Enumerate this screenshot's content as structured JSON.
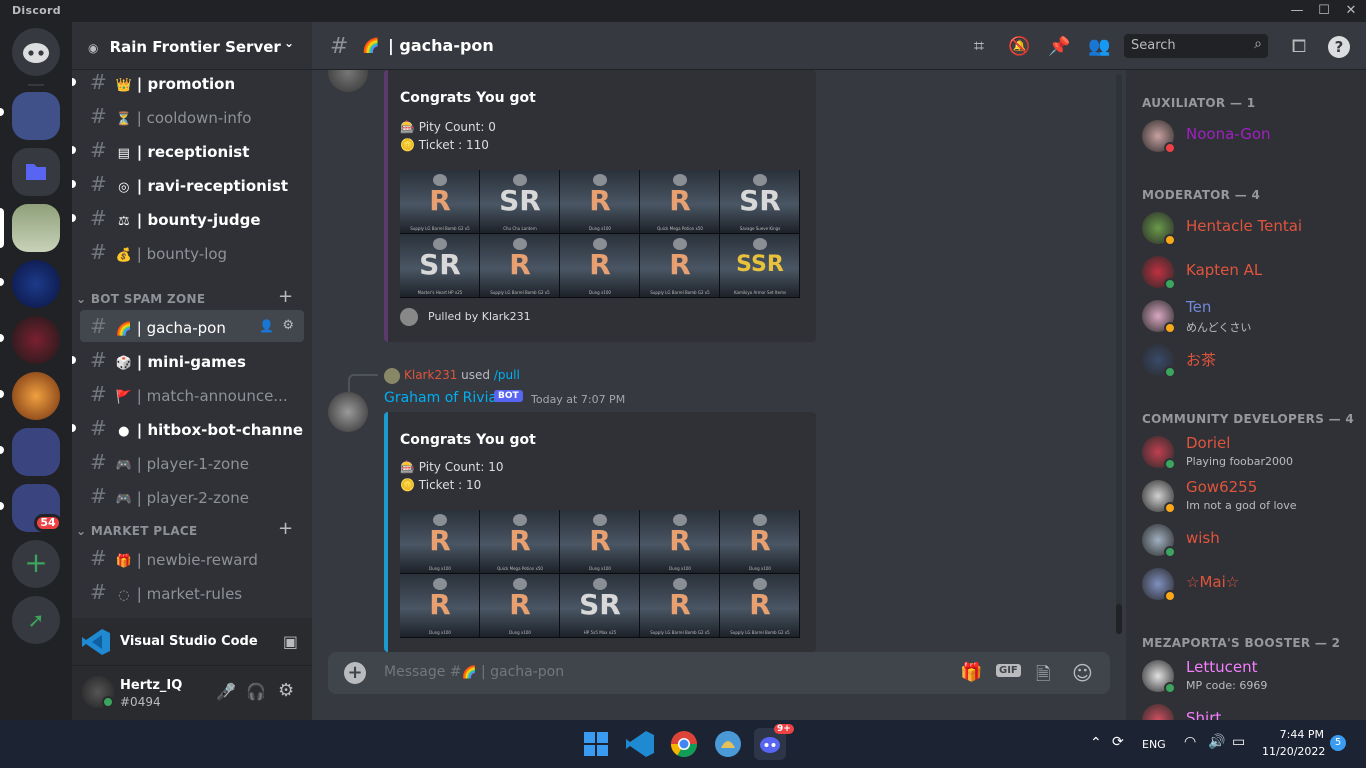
{
  "app": {
    "title": "Discord"
  },
  "window_controls": {
    "minimize": "—",
    "maximize": "☐",
    "close": "✕"
  },
  "servers": {
    "badge": "54",
    "add_label": "+",
    "explore_label": "➚"
  },
  "server": {
    "name": "Rain Frontier Server"
  },
  "channels": [
    {
      "emoji": "👑",
      "name": "| promotion",
      "unread": true
    },
    {
      "emoji": "⏳",
      "name": "| cooldown-info",
      "unread": false
    },
    {
      "emoji": "▤",
      "name": "| receptionist",
      "unread": true
    },
    {
      "emoji": "◎",
      "name": "| ravi-receptionist",
      "unread": true
    },
    {
      "emoji": "⚖",
      "name": "| bounty-judge",
      "unread": true
    },
    {
      "emoji": "💰",
      "name": "| bounty-log",
      "unread": false
    }
  ],
  "categories": {
    "bot_spam": "BOT SPAM ZONE",
    "market": "MARKET PLACE"
  },
  "bot_channels": [
    {
      "emoji": "🌈",
      "name": "| gacha-pon",
      "active": true,
      "unread": false
    },
    {
      "emoji": "🎲",
      "name": "| mini-games",
      "active": false,
      "unread": true
    },
    {
      "emoji": "🚩",
      "name": "| match-announce...",
      "active": false,
      "unread": false
    },
    {
      "emoji": "●",
      "name": "| hitbox-bot-channel",
      "active": false,
      "unread": true
    },
    {
      "emoji": "🎮",
      "name": "| player-1-zone",
      "active": false,
      "unread": false
    },
    {
      "emoji": "🎮",
      "name": "| player-2-zone",
      "active": false,
      "unread": false
    }
  ],
  "market_channels": [
    {
      "emoji": "🎁",
      "name": "| newbie-reward"
    },
    {
      "emoji": "◌",
      "name": "| market-rules"
    }
  ],
  "activity": {
    "name": "Visual Studio Code"
  },
  "user": {
    "name": "Hertz_IQ",
    "tag": "#0494"
  },
  "header": {
    "channel": "| gacha-pon",
    "search_placeholder": "Search"
  },
  "messages": {
    "first": {
      "title": "Congrats You got",
      "pity": "Pity Count: 0",
      "ticket": "Ticket : 110",
      "footer": "Pulled by Klark231",
      "cards": [
        {
          "rank": "R",
          "cap": "Supply LG Barrel Bomb G2 x5"
        },
        {
          "rank": "SR",
          "cap": "Chu Chu Lantern"
        },
        {
          "rank": "R",
          "cap": "Dung x100"
        },
        {
          "rank": "R",
          "cap": "Quick Mega Potion x50"
        },
        {
          "rank": "SR",
          "cap": "Savage Sueve Kings"
        },
        {
          "rank": "SR",
          "cap": "Master's Heart HP x25"
        },
        {
          "rank": "R",
          "cap": "Supply LG Barrel Bomb G2 x5"
        },
        {
          "rank": "R",
          "cap": "Dung x100"
        },
        {
          "rank": "R",
          "cap": "Supply LG Barrel Bomb G2 x5"
        },
        {
          "rank": "SSR",
          "cap": "Kamikiyo Armor Set Items"
        }
      ]
    },
    "second": {
      "reply_user": "Klark231",
      "reply_used": "used",
      "reply_cmd": "/pull",
      "author": "Graham of Rivia",
      "bot_tag": "BOT",
      "time": "Today at 7:07 PM",
      "title": "Congrats You got",
      "pity": "Pity Count: 10",
      "ticket": "Ticket : 10",
      "cards": [
        {
          "rank": "R",
          "cap": "Dung x100"
        },
        {
          "rank": "R",
          "cap": "Quick Mega Potion x50"
        },
        {
          "rank": "R",
          "cap": "Dung x100"
        },
        {
          "rank": "R",
          "cap": "Dung x100"
        },
        {
          "rank": "R",
          "cap": "Dung x100"
        },
        {
          "rank": "R",
          "cap": "Dung x100"
        },
        {
          "rank": "R",
          "cap": "Dung x100"
        },
        {
          "rank": "SR",
          "cap": "HP 5x5 Max x25"
        },
        {
          "rank": "R",
          "cap": "Supply LG Barrel Bomb G2 x5"
        },
        {
          "rank": "R",
          "cap": "Supply LG Barrel Bomb G2 x5"
        }
      ]
    }
  },
  "composer": {
    "placeholder_prefix": "Message #",
    "placeholder_channel": "| gacha-pon",
    "gif": "GIF"
  },
  "members": {
    "groups": [
      {
        "label": "AUXILIATOR — 1",
        "members": [
          {
            "name": "Noona-Gon",
            "color": "#a020c0",
            "sub": "",
            "status": "#ed4245"
          }
        ]
      },
      {
        "label": "MODERATOR — 4",
        "members": [
          {
            "name": "Hentacle Tentai",
            "color": "#e0543c",
            "sub": "",
            "status": "#faa81a"
          },
          {
            "name": "Kapten AL",
            "color": "#e0543c",
            "sub": "",
            "status": "#3ba55d"
          },
          {
            "name": "Ten",
            "color": "#7289da",
            "sub": "めんどくさい",
            "status": "#faa81a"
          },
          {
            "name": "お茶",
            "color": "#e0543c",
            "sub": "",
            "status": "#3ba55d"
          }
        ]
      },
      {
        "label": "COMMUNITY DEVELOPERS — 4",
        "members": [
          {
            "name": "Doriel",
            "color": "#e0543c",
            "sub": "Playing foobar2000",
            "status": "#3ba55d"
          },
          {
            "name": "Gow6255",
            "color": "#e0543c",
            "sub": "Im not a god of love",
            "status": "#faa81a"
          },
          {
            "name": "wish",
            "color": "#e0543c",
            "sub": "",
            "status": "#3ba55d"
          },
          {
            "name": "☆Mai☆",
            "color": "#e0543c",
            "sub": "",
            "status": "#faa81a"
          }
        ]
      },
      {
        "label": "MEZAPORTA'S BOOSTER — 2",
        "members": [
          {
            "name": "Lettucent",
            "color": "#f47fff",
            "sub": "MP code: 6969",
            "status": "#3ba55d"
          },
          {
            "name": "Shirt",
            "color": "#f47fff",
            "sub": "",
            "status": "#faa81a"
          }
        ]
      }
    ]
  },
  "taskbar": {
    "lang": "ENG",
    "time": "7:44 PM",
    "date": "11/20/2022",
    "notif": "5",
    "discord_badge": "9+"
  }
}
